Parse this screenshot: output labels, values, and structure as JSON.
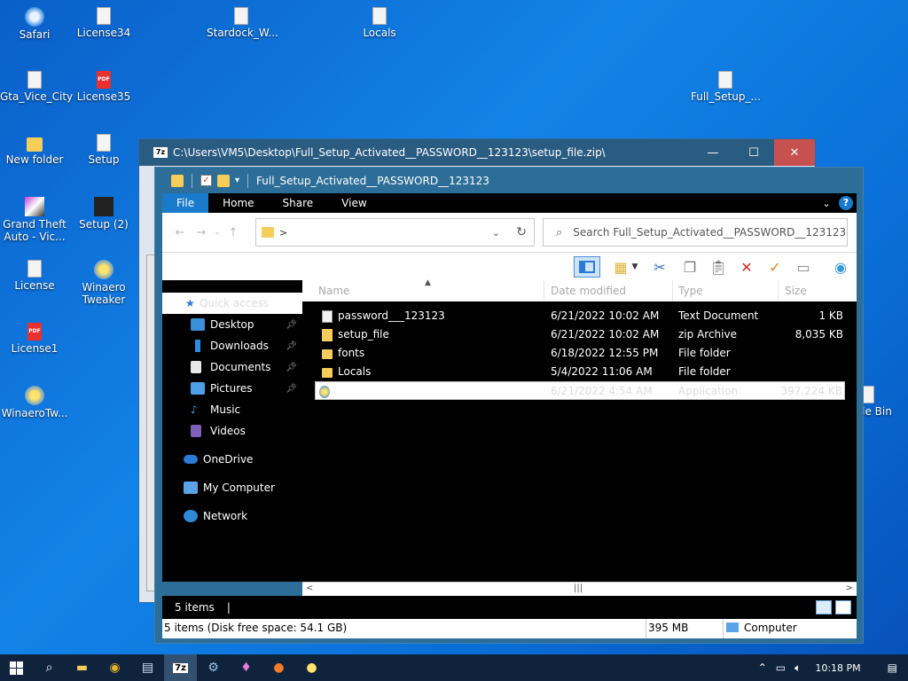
{
  "desktop": {
    "icons": [
      {
        "label": "Safari"
      },
      {
        "label": "License34"
      },
      {
        "label": "Stardock_W..."
      },
      {
        "label": "Locals"
      },
      {
        "label": "Gta_Vice_City"
      },
      {
        "label": "License35"
      },
      {
        "label": "Full_Setup_..."
      },
      {
        "label": "New folder"
      },
      {
        "label": "Setup"
      },
      {
        "label": "Grand Theft Auto - Vic..."
      },
      {
        "label": "Setup (2)"
      },
      {
        "label": "License"
      },
      {
        "label": "Winaero Tweaker"
      },
      {
        "label": "License1"
      },
      {
        "label": "WinaeroTw..."
      },
      {
        "label": "le Bin"
      }
    ],
    "pdf_badge": "PDF"
  },
  "sevenzip": {
    "title": "C:\\Users\\VM5\\Desktop\\Full_Setup_Activated__PASSWORD__123123\\setup_file.zip\\",
    "app_badge": "7z",
    "minimize": "—",
    "maximize": "☐",
    "close": "✕"
  },
  "explorer": {
    "title": "Full_Setup_Activated__PASSWORD__123123",
    "ribbon": {
      "file": "File",
      "home": "Home",
      "share": "Share",
      "view": "View",
      "help": "?"
    },
    "address": {
      "chevron": ">",
      "search_placeholder": "Search Full_Setup_Activated__PASSWORD__123123"
    },
    "nav": {
      "quick_access": "Quick access",
      "items": [
        {
          "label": "Desktop",
          "pinned": true
        },
        {
          "label": "Downloads",
          "pinned": true
        },
        {
          "label": "Documents",
          "pinned": true
        },
        {
          "label": "Pictures",
          "pinned": true
        },
        {
          "label": "Music"
        },
        {
          "label": "Videos"
        },
        {
          "label": "OneDrive"
        },
        {
          "label": "My Computer"
        },
        {
          "label": "Network"
        }
      ]
    },
    "columns": {
      "name": "Name",
      "date": "Date modified",
      "type": "Type",
      "size": "Size"
    },
    "files": [
      {
        "name": "password___123123",
        "date": "6/21/2022 10:02 AM",
        "type": "Text Document",
        "size": "1 KB"
      },
      {
        "name": "setup_file",
        "date": "6/21/2022 10:02 AM",
        "type": "zip Archive",
        "size": "8,035 KB"
      },
      {
        "name": "fonts",
        "date": "6/18/2022 12:55 PM",
        "type": "File folder",
        "size": ""
      },
      {
        "name": "Locals",
        "date": "5/4/2022 11:06 AM",
        "type": "File folder",
        "size": ""
      },
      {
        "name": "",
        "date": "6/21/2022 4:54 AM",
        "type": "Application",
        "size": "397,224 KB"
      }
    ],
    "status": {
      "items": "5 items",
      "caret": "|",
      "details": "5 items (Disk free space: 54.1 GB)",
      "size": "395 MB",
      "location": "Computer"
    }
  },
  "taskbar": {
    "clock": "10:18 PM"
  }
}
